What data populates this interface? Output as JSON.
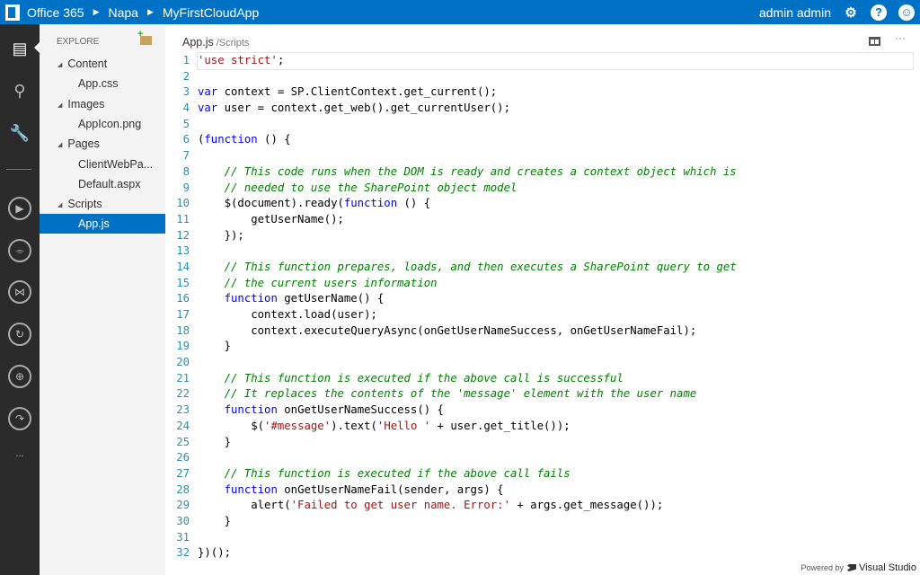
{
  "topbar": {
    "breadcrumbs": [
      "Office 365",
      "Napa",
      "MyFirstCloudApp"
    ],
    "user": "admin admin",
    "icons": [
      "settings-icon",
      "help-icon",
      "smiley-icon"
    ]
  },
  "rail": {
    "icons": [
      "files-icon",
      "search-icon",
      "tools-icon",
      "run-icon",
      "clean-icon",
      "deploy-visual-studio-icon",
      "refresh-icon",
      "publish-icon",
      "redo-icon",
      "more-icon"
    ],
    "more": "..."
  },
  "explorer": {
    "title": "EXPLORE",
    "items": [
      {
        "label": "Content",
        "kind": "folder"
      },
      {
        "label": "App.css",
        "kind": "file"
      },
      {
        "label": "Images",
        "kind": "folder"
      },
      {
        "label": "AppIcon.png",
        "kind": "file"
      },
      {
        "label": "Pages",
        "kind": "folder"
      },
      {
        "label": "ClientWebPa...",
        "kind": "file"
      },
      {
        "label": "Default.aspx",
        "kind": "file"
      },
      {
        "label": "Scripts",
        "kind": "folder"
      },
      {
        "label": "App.js",
        "kind": "file",
        "selected": true
      }
    ]
  },
  "editor": {
    "filename": "App.js",
    "path": "/Scripts",
    "more": "···",
    "lines": [
      [
        [
          "str",
          "'use strict'"
        ],
        [
          "t",
          ";"
        ]
      ],
      [],
      [
        [
          "kw",
          "var"
        ],
        [
          "t",
          " context = SP.ClientContext.get_current();"
        ]
      ],
      [
        [
          "kw",
          "var"
        ],
        [
          "t",
          " user = context.get_web().get_currentUser();"
        ]
      ],
      [],
      [
        [
          "t",
          "("
        ],
        [
          "kw",
          "function"
        ],
        [
          "t",
          " () {"
        ]
      ],
      [],
      [
        [
          "t",
          "    "
        ],
        [
          "cm",
          "// This code runs when the DOM is ready and creates a context object which is"
        ]
      ],
      [
        [
          "t",
          "    "
        ],
        [
          "cm",
          "// needed to use the SharePoint object model"
        ]
      ],
      [
        [
          "t",
          "    $(document).ready("
        ],
        [
          "kw",
          "function"
        ],
        [
          "t",
          " () {"
        ]
      ],
      [
        [
          "t",
          "        getUserName();"
        ]
      ],
      [
        [
          "t",
          "    });"
        ]
      ],
      [],
      [
        [
          "t",
          "    "
        ],
        [
          "cm",
          "// This function prepares, loads, and then executes a SharePoint query to get"
        ]
      ],
      [
        [
          "t",
          "    "
        ],
        [
          "cm",
          "// the current users information"
        ]
      ],
      [
        [
          "t",
          "    "
        ],
        [
          "kw",
          "function"
        ],
        [
          "t",
          " getUserName() {"
        ]
      ],
      [
        [
          "t",
          "        context.load(user);"
        ]
      ],
      [
        [
          "t",
          "        context.executeQueryAsync(onGetUserNameSuccess, onGetUserNameFail);"
        ]
      ],
      [
        [
          "t",
          "    }"
        ]
      ],
      [],
      [
        [
          "t",
          "    "
        ],
        [
          "cm",
          "// This function is executed if the above call is successful"
        ]
      ],
      [
        [
          "t",
          "    "
        ],
        [
          "cm",
          "// It replaces the contents of the 'message' element with the user name"
        ]
      ],
      [
        [
          "t",
          "    "
        ],
        [
          "kw",
          "function"
        ],
        [
          "t",
          " onGetUserNameSuccess() {"
        ]
      ],
      [
        [
          "t",
          "        $("
        ],
        [
          "str",
          "'#message'"
        ],
        [
          "t",
          ").text("
        ],
        [
          "str",
          "'Hello '"
        ],
        [
          "t",
          " + user.get_title());"
        ]
      ],
      [
        [
          "t",
          "    }"
        ]
      ],
      [],
      [
        [
          "t",
          "    "
        ],
        [
          "cm",
          "// This function is executed if the above call fails"
        ]
      ],
      [
        [
          "t",
          "    "
        ],
        [
          "kw",
          "function"
        ],
        [
          "t",
          " onGetUserNameFail(sender, args) {"
        ]
      ],
      [
        [
          "t",
          "        alert("
        ],
        [
          "str",
          "'Failed to get user name. Error:'"
        ],
        [
          "t",
          " + args.get_message());"
        ]
      ],
      [
        [
          "t",
          "    }"
        ]
      ],
      [],
      [
        [
          "t",
          "})();"
        ]
      ]
    ]
  },
  "footer": {
    "powered": "Powered by",
    "product": "Visual Studio"
  }
}
